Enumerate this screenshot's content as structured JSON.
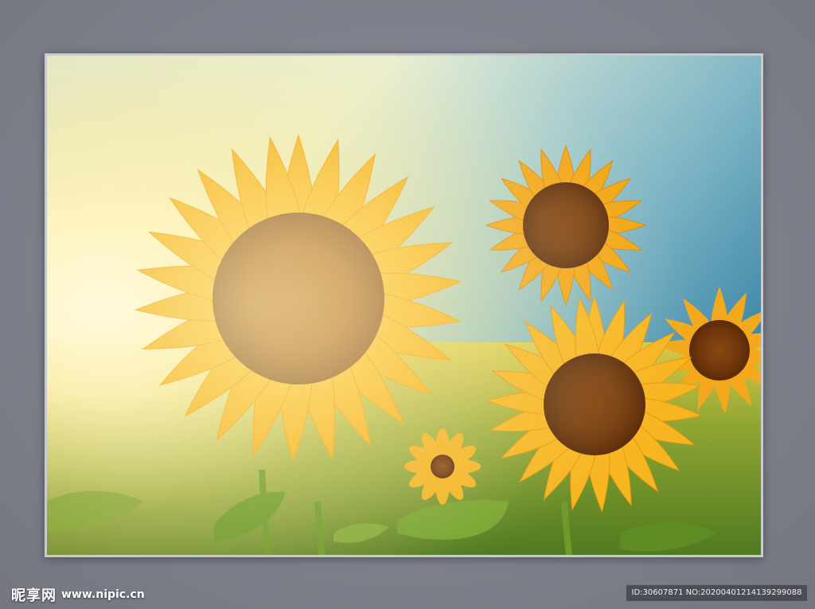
{
  "image": {
    "subject": "sunflowers",
    "colors": {
      "sky_top": "#3d8fb0",
      "sun_glow": "#fff7d0",
      "petal": "#f7b81c",
      "center": "#8a4a10",
      "leaf": "#6f9a2a"
    }
  },
  "watermark": {
    "logo_text": "昵享网",
    "site_url": "www.nipic.cn",
    "id_text": "ID:30607871 NO:20200401214139299088"
  }
}
